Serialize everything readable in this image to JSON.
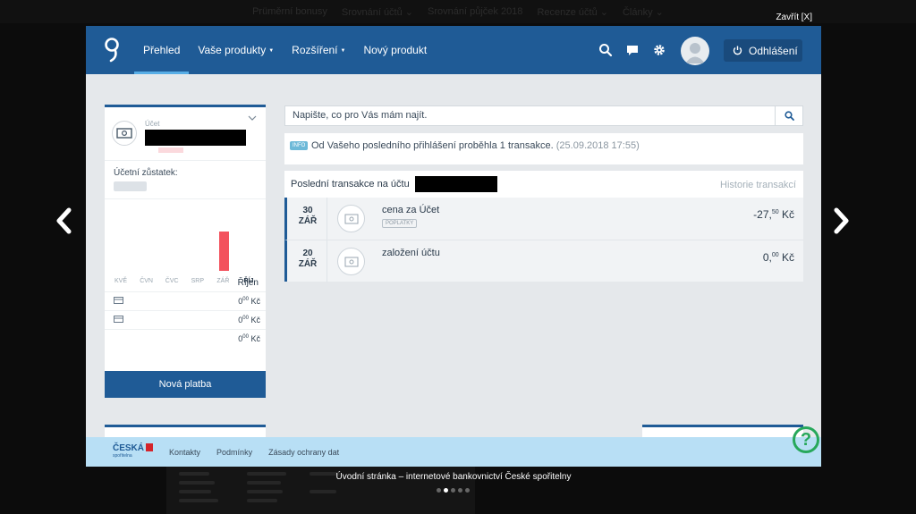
{
  "background_nav": [
    "Prüměrní bonusy",
    "Srovnání účtů ⌄",
    "Srovnání půjček 2018",
    "Recenze účtů ⌄",
    "Články ⌄"
  ],
  "lightbox": {
    "close_label": "Zavřít [X]",
    "caption": "Úvodní stránka – internetové bankovnictví České spořitelny",
    "slide_count": 5,
    "active_slide": 1
  },
  "header": {
    "nav": [
      {
        "label": "Přehled",
        "active": true,
        "dropdown": false
      },
      {
        "label": "Vaše produkty",
        "active": false,
        "dropdown": true
      },
      {
        "label": "Rozšíření",
        "active": false,
        "dropdown": true
      },
      {
        "label": "Nový produkt",
        "active": false,
        "dropdown": false
      }
    ],
    "logout_label": "Odhlášení",
    "icons": [
      "search-icon",
      "chat-icon",
      "gear-icon",
      "avatar-icon",
      "power-icon"
    ]
  },
  "account_card": {
    "label": "Účet",
    "balance_label": "Účetní zůstatek:",
    "months": [
      "KVĚ",
      "ČVN",
      "ČVC",
      "SRP",
      "ZÁŘ",
      "ŘÍJ"
    ],
    "month_values": [
      0,
      0,
      0,
      0,
      27.5,
      0
    ],
    "month_title": "Říjen",
    "rows": [
      {
        "icon": "card-icon",
        "amount_main": "0",
        "amount_dec": "00",
        "currency": "Kč"
      },
      {
        "icon": "card-icon",
        "amount_main": "0",
        "amount_dec": "00",
        "currency": "Kč"
      },
      {
        "icon": "",
        "amount_main": "0",
        "amount_dec": "00",
        "currency": "Kč"
      }
    ],
    "payment_button": "Nová platba"
  },
  "search": {
    "placeholder": "Napište, co pro Vás mám najít."
  },
  "info": {
    "badge": "INFO",
    "text": "Od Vašeho posledního přihlášení proběhla 1 transakce.",
    "date": "(25.09.2018 17:55)"
  },
  "transactions": {
    "title": "Poslední transakce na účtu",
    "history_link": "Historie transakcí",
    "rows": [
      {
        "day": "30",
        "month": "ZÁŘ",
        "name": "cena za Účet",
        "tag": "POPLATKY",
        "amount_main": "-27,",
        "amount_dec": "50",
        "currency": "Kč"
      },
      {
        "day": "20",
        "month": "ZÁŘ",
        "name": "založení účtu",
        "tag": "",
        "amount_main": "0,",
        "amount_dec": "00",
        "currency": "Kč"
      }
    ]
  },
  "footer": {
    "brand_main": "ČESKÁ",
    "brand_sub": "spořitelna",
    "links": [
      "Kontakty",
      "Podmínky",
      "Zásady ochrany dat"
    ],
    "help": "?"
  },
  "colors": {
    "primary": "#1f5b96",
    "accent": "#58aee6",
    "bar": "#f3515d",
    "help": "#27a85b"
  }
}
